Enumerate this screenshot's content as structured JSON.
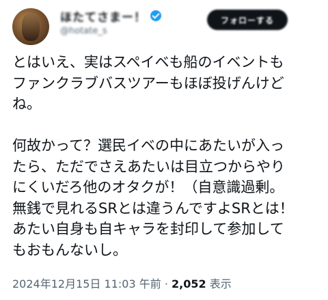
{
  "author": {
    "display_name": "ほたてさまー！",
    "handle": "@hotate_s",
    "verified": true,
    "avatar": "profile-photo"
  },
  "follow_button": {
    "label": "フォローする"
  },
  "tweet": {
    "lines": [
      "とはいえ、実はスペイベも船のイベントも",
      "ファンクラブバスツアーもほぼ投げんけど",
      "ね。",
      "",
      "何故かって？選民イベの中にあたいが入っ",
      "たら、ただでさえあたいは目立つからやり",
      "にくいだろ他のオタクが！（自意識過剰。",
      "無銭で見れるSRとは違うんですよSRとは！",
      "あたい自身も自キャラを封印して参加して",
      "もおもんないし。"
    ]
  },
  "meta": {
    "timestamp": "2024年12月15日 11:03 午前",
    "separator": " · ",
    "views": "2,052",
    "views_label": " 表示"
  },
  "colors": {
    "text": "#0f1419",
    "secondary": "#536471",
    "verified": "#1d9bf0",
    "button_bg": "#0f1419"
  }
}
